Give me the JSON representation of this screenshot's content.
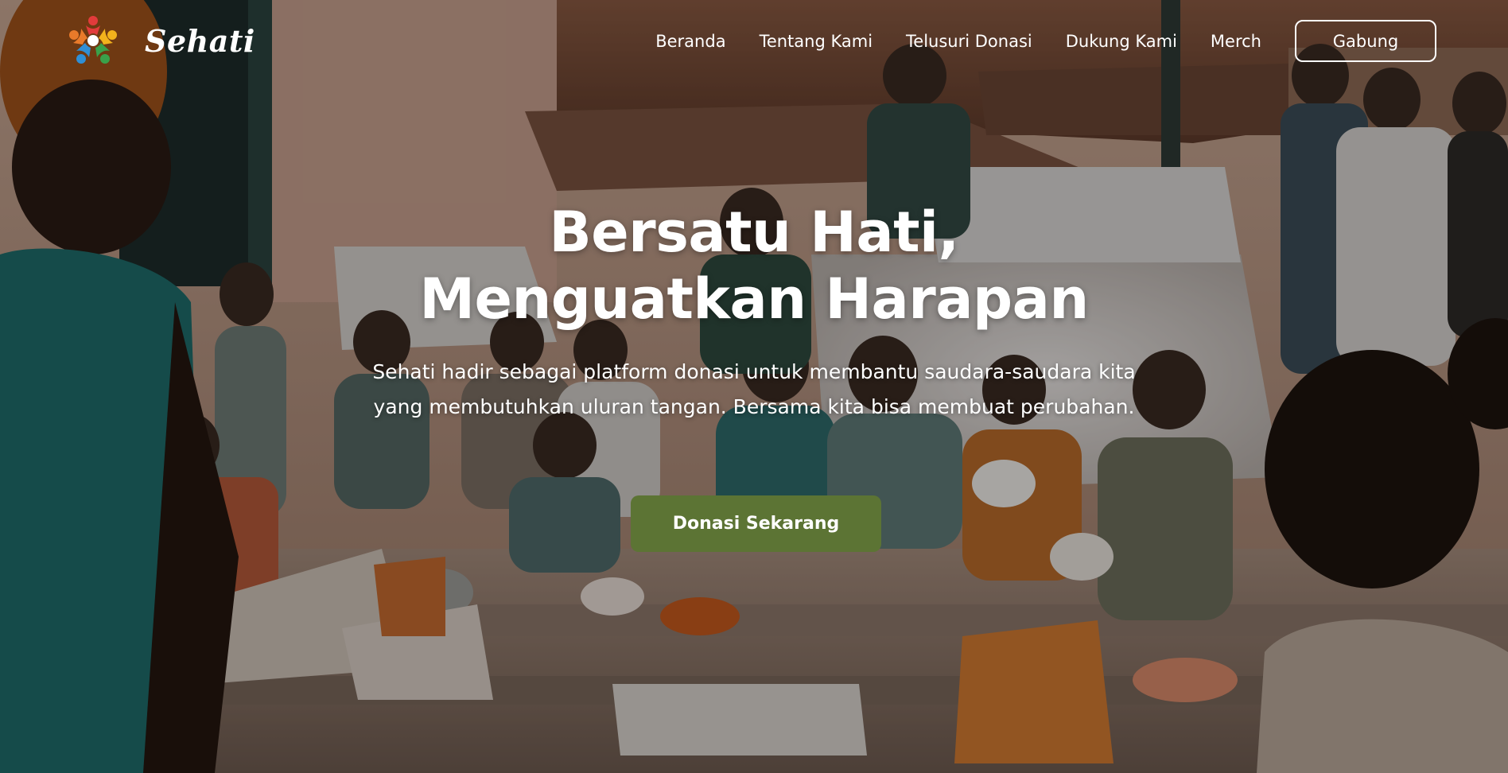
{
  "brand": {
    "name": "Sehati",
    "logo_icon": "colorful-people-circle-logo",
    "logo_colors": [
      "#e23b3b",
      "#f2b21c",
      "#3aa14a",
      "#2f8fd6",
      "#e97a2a"
    ]
  },
  "nav": {
    "links": [
      {
        "label": "Beranda"
      },
      {
        "label": "Tentang Kami"
      },
      {
        "label": "Telusuri Donasi"
      },
      {
        "label": "Dukung Kami"
      },
      {
        "label": "Merch"
      }
    ],
    "join_label": "Gabung"
  },
  "hero": {
    "title_line1": "Bersatu Hati,",
    "title_line2": "Menguatkan Harapan",
    "description": "Sehati hadir sebagai platform donasi untuk membantu saudara-saudara kita yang membutuhkan uluran tangan. Bersama kita bisa membuat perubahan.",
    "cta_label": "Donasi Sekarang",
    "cta_color": "#5c7434",
    "background_image": "children-sitting-on-steps-photo"
  }
}
